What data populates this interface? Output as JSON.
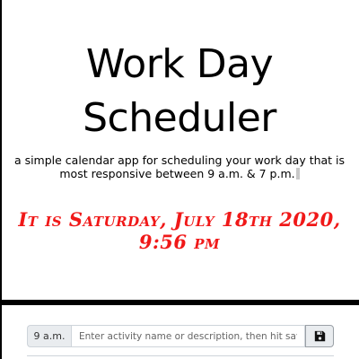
{
  "header": {
    "title": "Work Day Scheduler",
    "lead": "a simple calendar app for scheduling your work day that is most responsive between 9 a.m. & 7 p.m.",
    "current_day": "It is Saturday, July 18th 2020, 9:56 pm",
    "accent_color": "#f01818"
  },
  "schedule": {
    "time_blocks": [
      {
        "hour": "9 a.m.",
        "placeholder": "Enter activity name or description, then hit save",
        "value": "",
        "save_icon": "floppy-disk-icon"
      }
    ]
  }
}
